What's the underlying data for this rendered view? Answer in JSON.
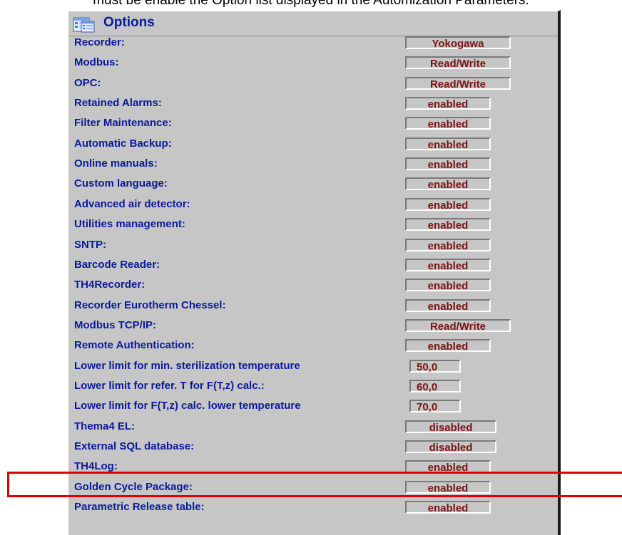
{
  "caption": "must be enable the Option list displayed in the Automization Parameters.",
  "panel": {
    "title": "Options",
    "icon": "options-window-icon"
  },
  "rows": [
    {
      "label": "Recorder:",
      "value": "Yokogawa",
      "kind": "wide"
    },
    {
      "label": "Modbus:",
      "value": "Read/Write",
      "kind": "wide"
    },
    {
      "label": "OPC:",
      "value": "Read/Write",
      "kind": "wide"
    },
    {
      "label": "Retained Alarms:",
      "value": "enabled",
      "kind": "enabled"
    },
    {
      "label": "Filter Maintenance:",
      "value": "enabled",
      "kind": "enabled"
    },
    {
      "label": "Automatic Backup:",
      "value": "enabled",
      "kind": "enabled"
    },
    {
      "label": "Online manuals:",
      "value": "enabled",
      "kind": "enabled"
    },
    {
      "label": "Custom language:",
      "value": "enabled",
      "kind": "enabled"
    },
    {
      "label": "Advanced air detector:",
      "value": "enabled",
      "kind": "enabled"
    },
    {
      "label": "Utilities management:",
      "value": "enabled",
      "kind": "enabled"
    },
    {
      "label": "SNTP:",
      "value": "enabled",
      "kind": "enabled"
    },
    {
      "label": "Barcode Reader:",
      "value": "enabled",
      "kind": "enabled"
    },
    {
      "label": "TH4Recorder:",
      "value": "enabled",
      "kind": "enabled"
    },
    {
      "label": "Recorder Eurotherm Chessel:",
      "value": "enabled",
      "kind": "enabled"
    },
    {
      "label": "Modbus TCP/IP:",
      "value": "Read/Write",
      "kind": "wide"
    },
    {
      "label": "Remote Authentication:",
      "value": "enabled",
      "kind": "enabled"
    },
    {
      "label": "Lower limit for min. sterilization temperature",
      "value": "50,0",
      "kind": "number"
    },
    {
      "label": "Lower limit for refer. T for F(T,z) calc.:",
      "value": "60,0",
      "kind": "number"
    },
    {
      "label": "Lower limit for F(T,z) calc. lower temperature",
      "value": "70,0",
      "kind": "number"
    },
    {
      "label": "Thema4 EL:",
      "value": "disabled",
      "kind": "disabled"
    },
    {
      "label": "External SQL database:",
      "value": "disabled",
      "kind": "disabled"
    },
    {
      "label": "TH4Log:",
      "value": "enabled",
      "kind": "enabled"
    },
    {
      "label": "Golden Cycle Package:",
      "value": "enabled",
      "kind": "enabled"
    },
    {
      "label": "Parametric Release table:",
      "value": "enabled",
      "kind": "enabled"
    }
  ],
  "highlight": {
    "row_label": "TH4Log:",
    "color": "#e00000"
  },
  "colors": {
    "label": "#0a1a9c",
    "value": "#7a1414",
    "panel_bg": "#c6c6c6"
  }
}
